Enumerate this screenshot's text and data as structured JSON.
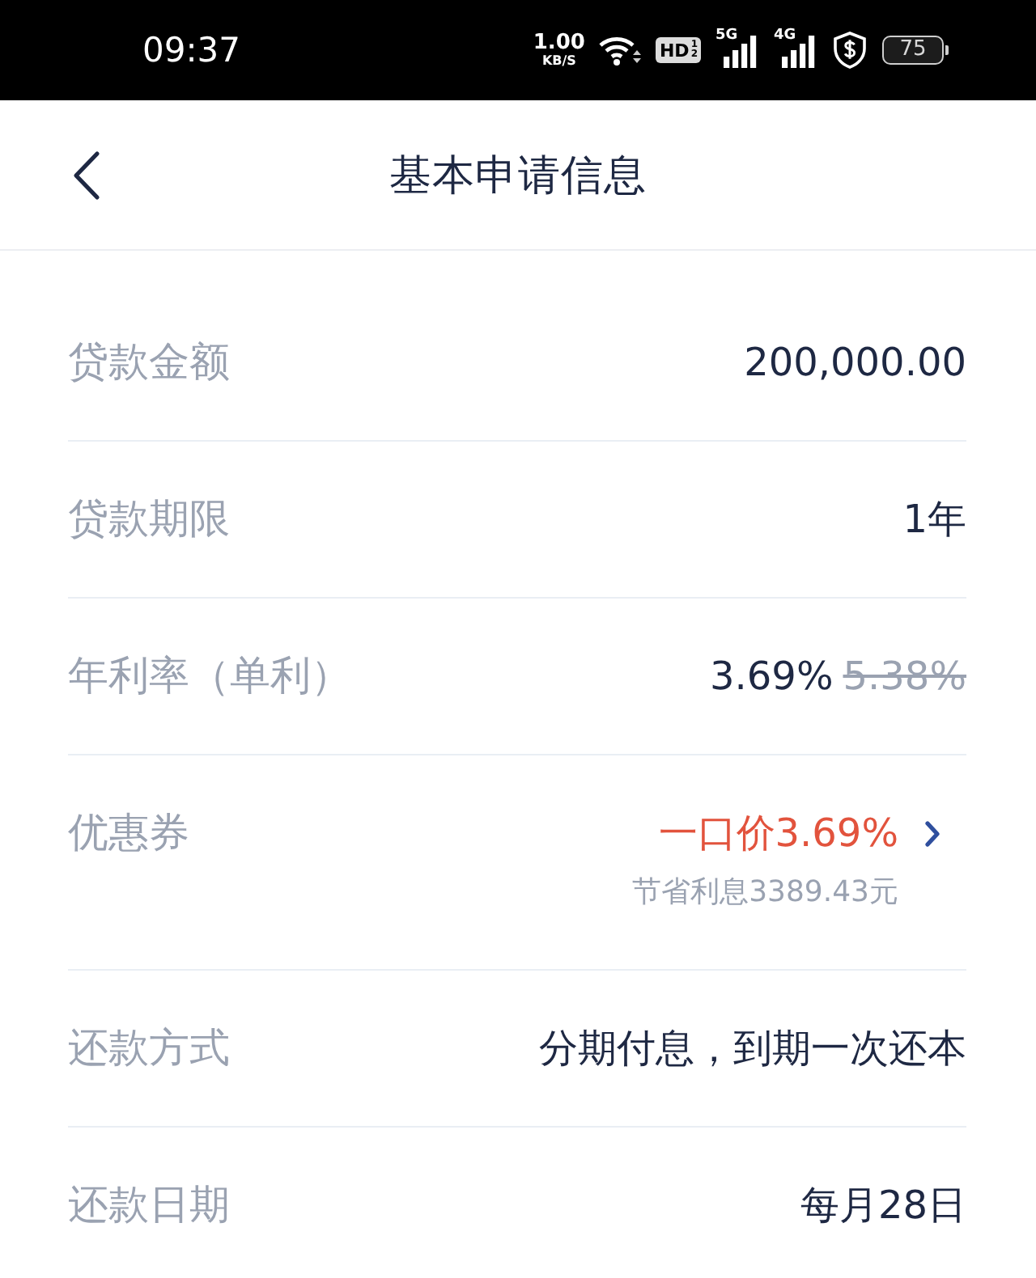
{
  "status_bar": {
    "time": "09:37",
    "net_speed": {
      "value": "1.00",
      "unit": "KB/S"
    },
    "hd": {
      "label": "HD",
      "slots": [
        "1",
        "2"
      ]
    },
    "signals": [
      {
        "label": "5G"
      },
      {
        "label": "4G"
      }
    ],
    "battery": {
      "label": "75"
    }
  },
  "header": {
    "title": "基本申请信息"
  },
  "rows": [
    {
      "kind": "plain",
      "label": "贷款金额",
      "value": "200,000.00"
    },
    {
      "kind": "plain",
      "label": "贷款期限",
      "value": "1年"
    },
    {
      "kind": "rate",
      "label": "年利率（单利）",
      "value": "3.69%",
      "original": "5.38%"
    },
    {
      "kind": "coupon",
      "label": "优惠券",
      "value": "一口价3.69%",
      "note": "节省利息3389.43元"
    },
    {
      "kind": "plain",
      "label": "还款方式",
      "value": "分期付息，到期一次还本"
    },
    {
      "kind": "plain",
      "label": "还款日期",
      "value": "每月28日"
    }
  ]
}
